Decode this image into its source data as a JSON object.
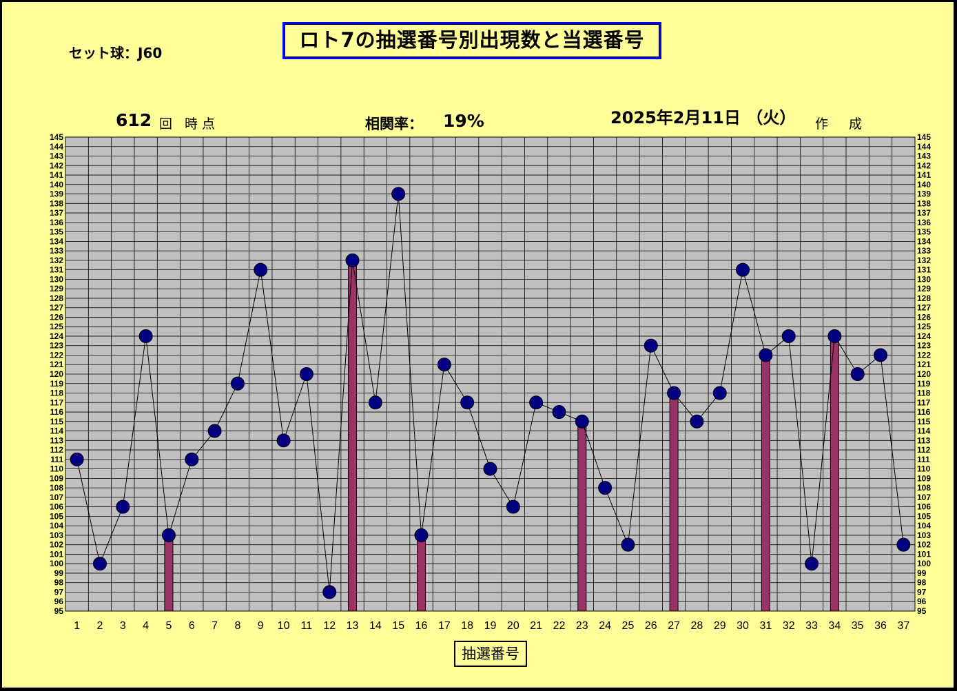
{
  "title": "ロト7の抽選番号別出現数と当選番号",
  "set_ball": "セット球：J60",
  "draw_count": "612",
  "draw_suffix": "回 時点",
  "correlation_label": "相関率：",
  "correlation_value": "19%",
  "date": "2025年2月11日 （火）",
  "made_label": "作 成",
  "colors": {
    "background": "#FFFF99",
    "plot_bg": "#C0C0C0",
    "marker": "#000080",
    "bar": "#993366",
    "title_border": "#0000FF"
  },
  "chart_data": {
    "type": "line",
    "title": "ロト7の抽選番号別出現数と当選番号",
    "xlabel": "抽選番号",
    "ylabel": "",
    "ylim": [
      95,
      145
    ],
    "grid": true,
    "categories": [
      "1",
      "2",
      "3",
      "4",
      "5",
      "6",
      "7",
      "8",
      "9",
      "10",
      "11",
      "12",
      "13",
      "14",
      "15",
      "16",
      "17",
      "18",
      "19",
      "20",
      "21",
      "22",
      "23",
      "24",
      "25",
      "26",
      "27",
      "28",
      "29",
      "30",
      "31",
      "32",
      "33",
      "34",
      "35",
      "36",
      "37"
    ],
    "series": [
      {
        "type": "line",
        "values": [
          111,
          100,
          106,
          124,
          103,
          111,
          114,
          119,
          131,
          113,
          120,
          97,
          132,
          117,
          139,
          103,
          121,
          117,
          110,
          106,
          117,
          116,
          115,
          108,
          102,
          123,
          118,
          115,
          118,
          131,
          122,
          124,
          100,
          124,
          120,
          122,
          102
        ]
      },
      {
        "type": "bar",
        "categories": [
          "5",
          "13",
          "16",
          "23",
          "27",
          "31",
          "34"
        ],
        "values": [
          103,
          132,
          103,
          115,
          118,
          122,
          124
        ]
      }
    ]
  }
}
